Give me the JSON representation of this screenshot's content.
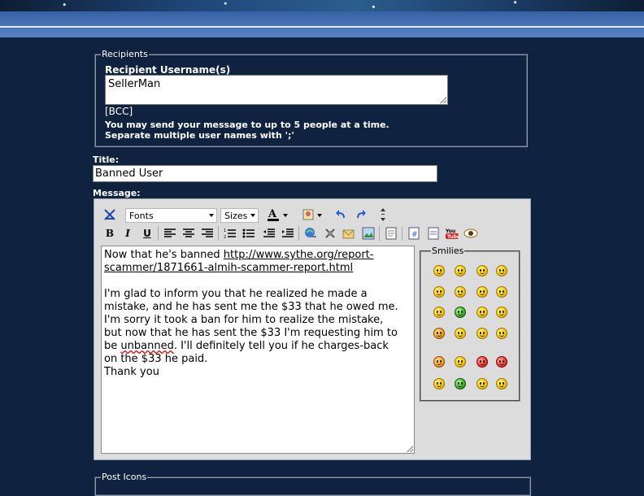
{
  "recipients": {
    "legend": "Recipients",
    "username_label": "Recipient Username(s)",
    "username_value": "SellerMan",
    "bcc_label": "[BCC]",
    "note_line1_prefix": "You may send your message to up to ",
    "note_line1_count": "5",
    "note_line1_suffix": " people at a time.",
    "note_line2": "Separate multiple user names with ';'"
  },
  "title": {
    "label": "Title:",
    "value": "Banned User"
  },
  "message": {
    "label": "Message:",
    "toolbar": {
      "font_select": "Fonts",
      "size_select": "Sizes",
      "bold": "B",
      "italic": "I",
      "underline": "U"
    },
    "lines": [
      {
        "pre": "Now that he's banned ",
        "link": "http://www.sythe.org/report-"
      },
      {
        "pre": "",
        "link": "scammer/1871661-almih-scammer-report.html"
      },
      {
        "pre": "",
        "link": ""
      },
      {
        "pre": "I'm glad to inform you that he realized he made a",
        "link": ""
      },
      {
        "pre": "mistake, and he has sent me the $33 that he owed me.",
        "link": ""
      },
      {
        "pre": "I'm sorry it took a ban for him to realize the mistake,",
        "link": ""
      },
      {
        "pre": "but now that he has sent the $33 I'm requesting him to",
        "link": ""
      },
      {
        "pre": "be ",
        "link": "unbanned",
        "post": ". I'll definitely tell you if he charges-back"
      },
      {
        "pre": "on the $33 he paid.",
        "link": ""
      },
      {
        "pre": "Thank you",
        "link": ""
      }
    ]
  },
  "smilies": {
    "legend": "Smilies"
  },
  "post_icons": {
    "legend": "Post Icons"
  }
}
